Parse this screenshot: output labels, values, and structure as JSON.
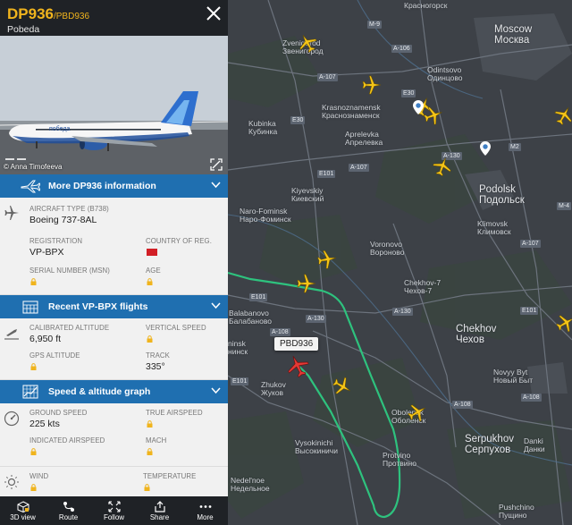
{
  "header": {
    "flight_number": "DP936",
    "callsign": "/PBD936",
    "airline": "Pobeda"
  },
  "photo": {
    "credit": "© Anna Timofeeva",
    "livery_text": "победа"
  },
  "sections": {
    "more_info": "More DP936 information",
    "recent_flights": "Recent VP-BPX flights",
    "graph": "Speed & altitude graph"
  },
  "aircraft": {
    "type_label": "AIRCRAFT TYPE",
    "type_code": "(B738)",
    "type_value": "Boeing 737-8AL",
    "registration_label": "REGISTRATION",
    "registration_value": "VP-BPX",
    "country_label": "COUNTRY OF REG.",
    "msn_label": "SERIAL NUMBER (MSN)",
    "age_label": "AGE"
  },
  "altitude": {
    "calibrated_label": "CALIBRATED ALTITUDE",
    "calibrated_value": "6,950 ft",
    "vertical_label": "VERTICAL SPEED",
    "gps_label": "GPS ALTITUDE",
    "track_label": "TRACK",
    "track_value": "335°"
  },
  "speed": {
    "ground_label": "GROUND SPEED",
    "ground_value": "225 kts",
    "true_label": "TRUE AIRSPEED",
    "indicated_label": "INDICATED AIRSPEED",
    "mach_label": "MACH"
  },
  "weather": {
    "wind_label": "WIND",
    "temperature_label": "TEMPERATURE"
  },
  "bottombar": [
    {
      "label": "3D view",
      "icon": "cube-icon"
    },
    {
      "label": "Route",
      "icon": "route-icon"
    },
    {
      "label": "Follow",
      "icon": "follow-icon"
    },
    {
      "label": "Share",
      "icon": "share-icon"
    },
    {
      "label": "More",
      "icon": "more-icon"
    }
  ],
  "map": {
    "flight_tag": "PBD936",
    "places": {
      "krasnogorsk": "Красногорск",
      "moscow_en": "Moscow",
      "moscow_ru": "Москва",
      "zvenigorod_en": "Zvenigorod",
      "zvenigorod_ru": "Звенигород",
      "odintsovo_en": "Odintsovo",
      "odintsovo_ru": "Одинцово",
      "kubinka_en": "Kubinka",
      "kubinka_ru": "Кубинка",
      "krasnoznamensk_en": "Krasnoznamensk",
      "krasnoznamensk_ru": "Краснознаменск",
      "aprelevka_en": "Aprelevka",
      "aprelevka_ru": "Апрелевка",
      "podolsk_en": "Podolsk",
      "podolsk_ru": "Подольск",
      "kiyevskiy_en": "Kiyevskiy",
      "kiyevskiy_ru": "Киевский",
      "naro_en": "Naro-Fominsk",
      "naro_ru": "Наро-Фоминск",
      "klimovsk_en": "Klimovsk",
      "klimovsk_ru": "Климовск",
      "voronovo_en": "Voronovo",
      "voronovo_ru": "Вороново",
      "chekhov7_en": "Chekhov-7",
      "chekhov7_ru": "Чехов-7",
      "balabanovo_en": "Balabanovo",
      "balabanovo_ru": "Балабаново",
      "obninsk_en": "ninsk",
      "obninsk_ru": "нинск",
      "chekhov_en": "Chekhov",
      "chekhov_ru": "Чехов",
      "novyy_en": "Novyy Byt",
      "novyy_ru": "Новый Быт",
      "zhukov_en": "Zhukov",
      "zhukov_ru": "Жуков",
      "obolensk_en": "Obolensk",
      "obolensk_ru": "Оболенск",
      "serpukhov_en": "Serpukhov",
      "serpukhov_ru": "Серпухов",
      "danki_en": "Danki",
      "danki_ru": "Данки",
      "vysokinichi_en": "Vysokinichi",
      "vysokinichi_ru": "Высокиничи",
      "protvino_en": "Protvino",
      "protvino_ru": "Протвино",
      "nedelnoe_en": "Nedel'noe",
      "nedelnoe_ru": "Недельное",
      "pushchino_en": "Pushchino",
      "pushchino_ru": "Пущино"
    },
    "roads": [
      "M-9",
      "A-106",
      "A-107",
      "E30",
      "E30",
      "A-130",
      "M2",
      "E101",
      "A-107",
      "A-130",
      "E101",
      "A-107",
      "A-130",
      "A-108",
      "E101",
      "A-108",
      "E101",
      "M-4",
      "A-108"
    ]
  }
}
